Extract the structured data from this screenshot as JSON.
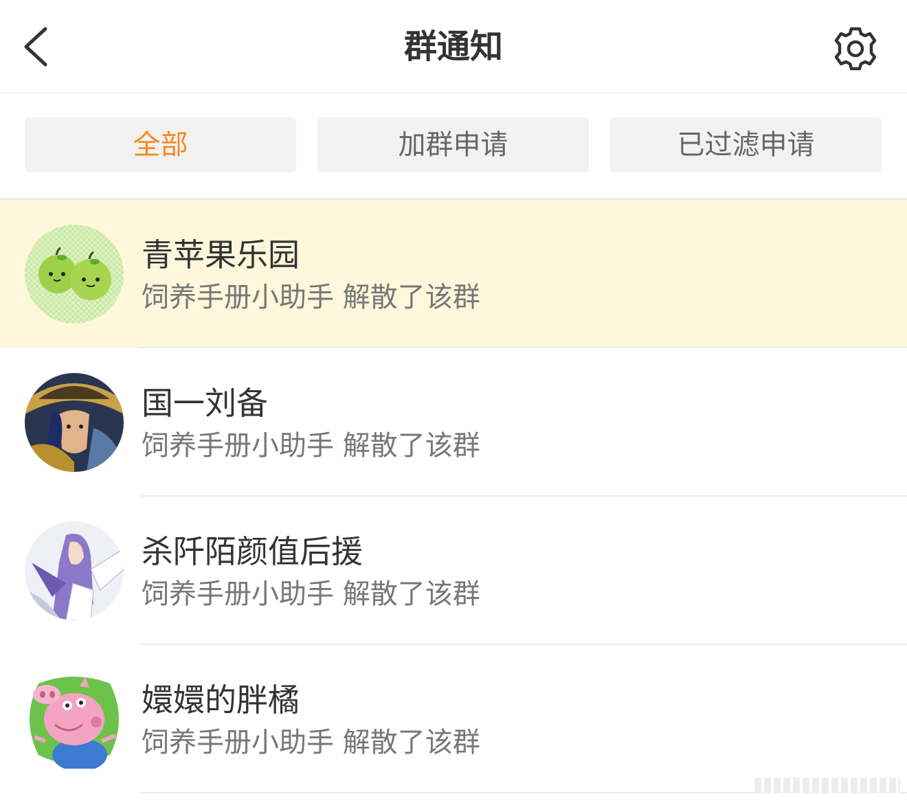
{
  "header": {
    "title": "群通知",
    "back_icon": "chevron-left-icon",
    "settings_icon": "gear-icon"
  },
  "tabs": [
    {
      "label": "全部",
      "active": true
    },
    {
      "label": "加群申请",
      "active": false
    },
    {
      "label": "已过滤申请",
      "active": false
    }
  ],
  "colors": {
    "accent": "#f48a1f",
    "highlight_row": "#fef7db",
    "tab_bg": "#f2f2f2"
  },
  "notifications": [
    {
      "name": "青苹果乐园",
      "message": "饲养手册小助手 解散了该群",
      "avatar": "green-apples-avatar",
      "highlighted": true
    },
    {
      "name": "国一刘备",
      "message": "饲养手册小助手 解散了该群",
      "avatar": "warrior-avatar",
      "highlighted": false
    },
    {
      "name": "杀阡陌颜值后援",
      "message": "饲养手册小助手 解散了该群",
      "avatar": "anime-character-avatar",
      "highlighted": false
    },
    {
      "name": "嬛嬛的胖橘",
      "message": "饲养手册小助手 解散了该群",
      "avatar": "cartoon-pig-avatar",
      "highlighted": false
    }
  ]
}
